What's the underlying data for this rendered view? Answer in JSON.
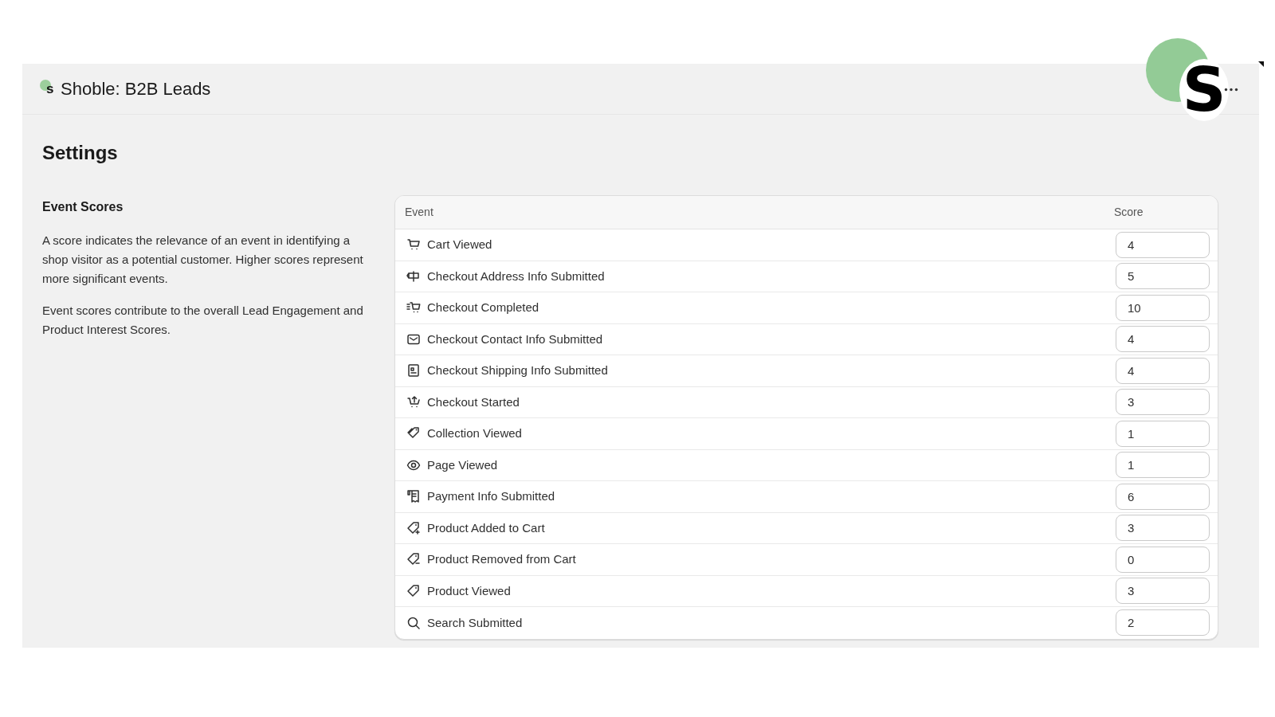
{
  "app": {
    "logo_letter": "s",
    "title": "Shoble: B2B Leads",
    "badge_letter": "S"
  },
  "page_title": "Settings",
  "section": {
    "title": "Event Scores",
    "paragraphs": [
      "A score indicates the relevance of an event in identifying a shop visitor as a potential customer. Higher scores represent more significant events.",
      "Event scores contribute to the overall Lead Engagement and Product Interest Scores."
    ]
  },
  "table": {
    "columns": [
      "Event",
      "Score"
    ],
    "rows": [
      {
        "event": "Cart Viewed",
        "score": "4"
      },
      {
        "event": "Checkout Address Info Submitted",
        "score": "5"
      },
      {
        "event": "Checkout Completed",
        "score": "10"
      },
      {
        "event": "Checkout Contact Info Submitted",
        "score": "4"
      },
      {
        "event": "Checkout Shipping Info Submitted",
        "score": "4"
      },
      {
        "event": "Checkout Started",
        "score": "3"
      },
      {
        "event": "Collection Viewed",
        "score": "1"
      },
      {
        "event": "Page Viewed",
        "score": "1"
      },
      {
        "event": "Payment Info Submitted",
        "score": "6"
      },
      {
        "event": "Product Added to Cart",
        "score": "3"
      },
      {
        "event": "Product Removed from Cart",
        "score": "0"
      },
      {
        "event": "Product Viewed",
        "score": "3"
      },
      {
        "event": "Search Submitted",
        "score": "2"
      }
    ]
  }
}
